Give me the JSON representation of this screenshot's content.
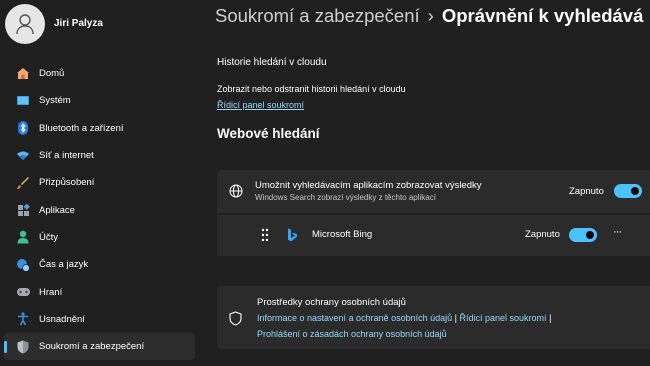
{
  "user": {
    "name": "Jiri Palyza"
  },
  "sidebar": {
    "items": [
      {
        "label": "Domů",
        "icon": "home-icon"
      },
      {
        "label": "Systém",
        "icon": "monitor-icon"
      },
      {
        "label": "Bluetooth a zařízení",
        "icon": "bluetooth-icon"
      },
      {
        "label": "Síť a internet",
        "icon": "wifi-icon"
      },
      {
        "label": "Přizpůsobení",
        "icon": "brush-icon"
      },
      {
        "label": "Aplikace",
        "icon": "apps-icon"
      },
      {
        "label": "Účty",
        "icon": "person-icon"
      },
      {
        "label": "Čas a jazyk",
        "icon": "globe-clock-icon"
      },
      {
        "label": "Hraní",
        "icon": "gamepad-icon"
      },
      {
        "label": "Usnadnění",
        "icon": "accessibility-icon"
      },
      {
        "label": "Soukromí a zabezpečení",
        "icon": "shield-icon",
        "active": true
      }
    ]
  },
  "header": {
    "parent": "Soukromí a zabezpečení",
    "separator": "›",
    "current": "Oprávnění k vyhledává"
  },
  "cloud_history": {
    "title": "Historie hledání v cloudu",
    "description": "Zobrazit nebo odstranit historii hledání v cloudu",
    "link": "Řídicí panel soukromí"
  },
  "web_search": {
    "title": "Webové hledání",
    "allow_setting": {
      "title": "Umožnit vyhledávacím aplikacím zobrazovat výsledky",
      "subtitle": "Windows Search zobrazí výsledky z těchto aplikací",
      "status": "Zapnuto",
      "enabled": true
    },
    "bing": {
      "name": "Microsoft Bing",
      "status": "Zapnuto",
      "enabled": true,
      "more": "···"
    }
  },
  "privacy_resources": {
    "title": "Prostředky ochrany osobních údajů",
    "link1": "Informace o nastavení a ochraně osobních údajů",
    "separator": "|",
    "link2": "Řídicí panel soukromí",
    "link3": "Prohlášení o zásadách ochrany osobních údajů"
  },
  "colors": {
    "accent": "#4cc2ff",
    "background": "#202020",
    "card": "#2b2b2b",
    "link": "#99d8ff"
  }
}
